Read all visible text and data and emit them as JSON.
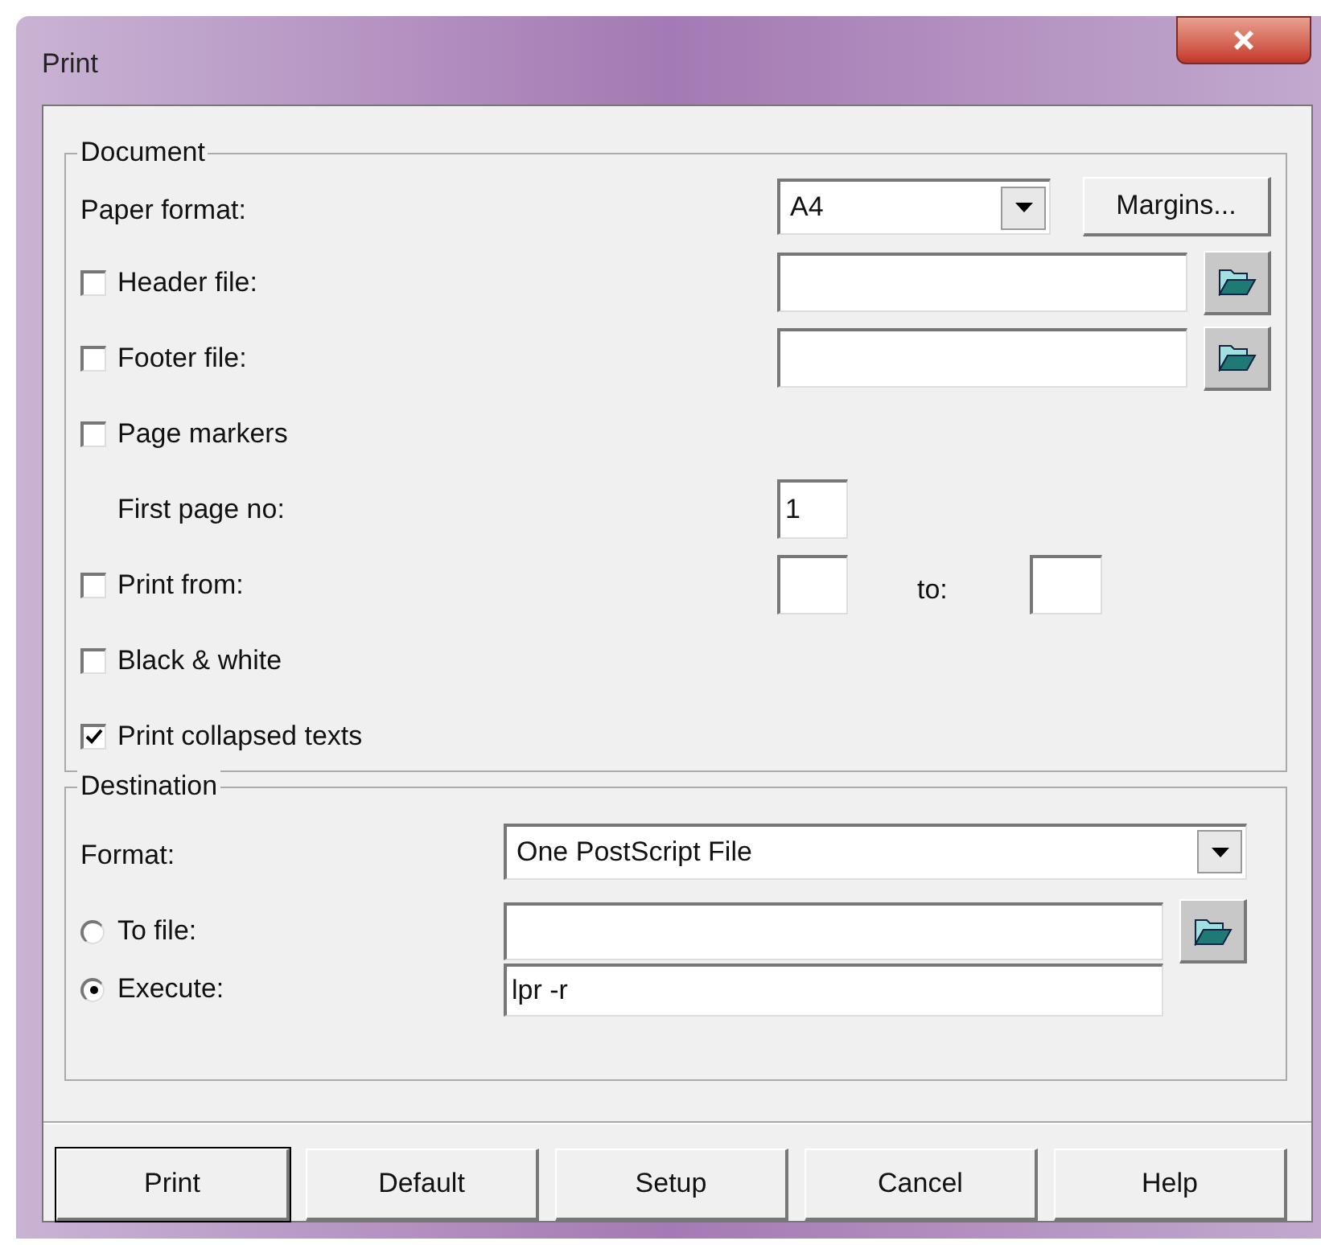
{
  "window": {
    "title": "Print"
  },
  "document": {
    "legend": "Document",
    "rows": [
      {
        "kind": "select",
        "label": "Paper format:",
        "value": "A4",
        "button": "Margins..."
      },
      {
        "kind": "file",
        "label": "Header file:",
        "checked": false
      },
      {
        "kind": "file",
        "label": "Footer file:",
        "checked": false
      },
      {
        "kind": "check",
        "label": "Page markers",
        "checked": false
      },
      {
        "kind": "number",
        "label": "First page no:",
        "value": "1"
      },
      {
        "kind": "range",
        "label": "Print from:",
        "checked": false,
        "to_label": "to:"
      },
      {
        "kind": "check",
        "label": "Black & white",
        "checked": false
      },
      {
        "kind": "check",
        "label": "Print collapsed texts",
        "checked": true
      }
    ]
  },
  "destination": {
    "legend": "Destination",
    "format": {
      "label": "Format:",
      "value": "One PostScript File"
    },
    "options": [
      {
        "kind": "file",
        "label": "To file:",
        "selected": false
      },
      {
        "kind": "text",
        "label": "Execute:",
        "selected": true,
        "value": "lpr -r"
      }
    ]
  },
  "buttons": [
    {
      "label": "Print",
      "default": true
    },
    {
      "label": "Default",
      "default": false
    },
    {
      "label": "Setup",
      "default": false
    },
    {
      "label": "Cancel",
      "default": false
    },
    {
      "label": "Help",
      "default": false
    }
  ]
}
